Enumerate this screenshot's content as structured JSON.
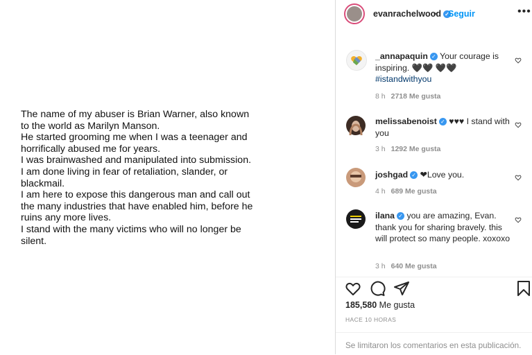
{
  "post": {
    "lines": [
      "The name of my abuser is Brian Warner, also known",
      "to the world as Marilyn Manson.",
      "He started grooming me when I was a teenager and",
      "horrifically abused me for years.",
      "I was brainwashed and manipulated into submission.",
      "I am done living in fear of retaliation, slander, or",
      "blackmail.",
      "I am here to expose this dangerous man and call out",
      "the many industries that have enabled him, before he",
      "ruins any more lives.",
      "I stand with the many victims who will no longer be",
      "silent."
    ]
  },
  "header": {
    "username": "evanrachelwood",
    "verified": "✓",
    "dot": "•",
    "follow_label": "Seguir",
    "more_label": "•••"
  },
  "comments": [
    {
      "username": "_annapaquin",
      "text": " Your courage is inspiring. 🖤🖤 🖤🖤",
      "hashtag": "#istandwithyou",
      "time": "8 h",
      "likes": "2718 Me gusta",
      "avatar_color": "#f4f4f4"
    },
    {
      "username": "melissabenoist",
      "text": " ♥♥♥ I stand with you",
      "hashtag": "",
      "time": "3 h",
      "likes": "1292 Me gusta",
      "avatar_color": "#3d2c24"
    },
    {
      "username": "joshgad",
      "text": " ❤Love you.",
      "hashtag": "",
      "time": "4 h",
      "likes": "689 Me gusta",
      "avatar_color": "#c99a7a"
    },
    {
      "username": "ilana",
      "text": " you are amazing, Evan. thank you for sharing bravely. this will protect so many people. xoxoxo",
      "hashtag": "",
      "time": "3 h",
      "likes": "640 Me gusta",
      "avatar_color": "#1a1a1a"
    }
  ],
  "likes": {
    "count": "185,580",
    "label": " Me gusta"
  },
  "timestamp": "HACE 10 HORAS",
  "footer": {
    "text": "Se limitaron los comentarios en esta publicación."
  },
  "colors": {
    "follow": "#0095f6",
    "verified": "#3897f0",
    "secondary_text": "#8e8e8e"
  },
  "icons": [
    "heart-icon",
    "comment-icon",
    "share-icon",
    "bookmark-icon",
    "more-options-icon",
    "verified-icon"
  ]
}
